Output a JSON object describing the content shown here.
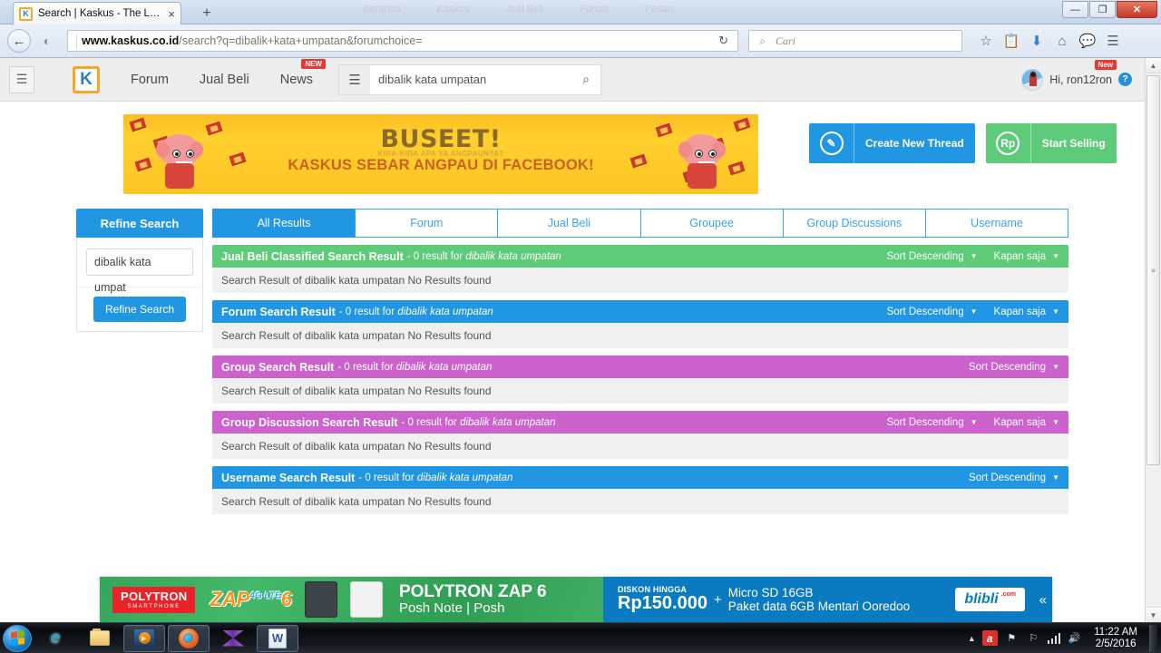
{
  "browser": {
    "tab_title": "Search | Kaskus - The Large...",
    "tab_favicon": "K",
    "tab_close_icon": "×",
    "new_tab_icon": "+",
    "ghost_tabs": [
      "Beranda",
      "Kaskus",
      "Jual Beli",
      "Forum",
      "Pesan"
    ],
    "window_minimize": "—",
    "window_restore": "❐",
    "window_close": "✕",
    "back_icon": "←",
    "forward_icon": "→",
    "url_site_icon": "◐",
    "url_domain": "www.kaskus.co.id",
    "url_path": "/search?q=dibalik+kata+umpatan&forumchoice=",
    "reload_icon": "↻",
    "search_placeholder": "Cari",
    "search_icon": "⌕",
    "toolbar_icons": [
      "☆",
      "Ὄb",
      "⬇",
      "⌂",
      "◔",
      "☰"
    ]
  },
  "site_nav": {
    "hamburger_icon": "☰",
    "logo_text": "K",
    "items": [
      {
        "label": "Forum",
        "badge": ""
      },
      {
        "label": "Jual Beli",
        "badge": ""
      },
      {
        "label": "News",
        "badge": "NEW"
      }
    ],
    "search_category_icon": "☰",
    "search_value": "dibalik kata umpatan",
    "search_go_icon": "⌕",
    "user_greeting": "Hi, ron12ron",
    "user_badge": "New",
    "help_icon": "?"
  },
  "hero": {
    "banner_line1": "BUSEET!",
    "banner_line2": "KIRA-KIRA APA YA ANGPAUNYA?",
    "banner_line3": "KASKUS SEBAR ANGPAU DI FACEBOOK!",
    "create_thread_label": "Create New Thread",
    "create_thread_icon": "✎",
    "start_selling_label": "Start Selling",
    "start_selling_icon": "Rp"
  },
  "refine": {
    "header": "Refine Search",
    "input_value": "dibalik kata umpat",
    "button_label": "Refine Search"
  },
  "tabs": [
    {
      "label": "All Results",
      "active": true
    },
    {
      "label": "Forum",
      "active": false
    },
    {
      "label": "Jual Beli",
      "active": false
    },
    {
      "label": "Groupee",
      "active": false
    },
    {
      "label": "Group Discussions",
      "active": false
    },
    {
      "label": "Username",
      "active": false
    }
  ],
  "query": "dibalik kata umpatan",
  "results": [
    {
      "title": "Jual Beli Classified Search Result",
      "meta_prefix": "- 0 result for",
      "meta_query": "dibalik kata umpatan",
      "color": "g-green",
      "sort_label": "Sort Descending",
      "time_label": "Kapan saja",
      "body": "Search Result of dibalik kata umpatan No Results found"
    },
    {
      "title": "Forum Search Result",
      "meta_prefix": "- 0 result for",
      "meta_query": "dibalik kata umpatan",
      "color": "g-blue",
      "sort_label": "Sort Descending",
      "time_label": "Kapan saja",
      "body": "Search Result of dibalik kata umpatan No Results found"
    },
    {
      "title": "Group Search Result",
      "meta_prefix": "- 0 result for",
      "meta_query": "dibalik kata umpatan",
      "color": "g-purple",
      "sort_label": "Sort Descending",
      "time_label": "",
      "body": "Search Result of dibalik kata umpatan No Results found"
    },
    {
      "title": "Group Discussion Search Result",
      "meta_prefix": "- 0 result for",
      "meta_query": "dibalik kata umpatan",
      "color": "g-purple",
      "sort_label": "Sort Descending",
      "time_label": "Kapan saja",
      "body": "Search Result of dibalik kata umpatan No Results found"
    },
    {
      "title": "Username Search Result",
      "meta_prefix": "- 0 result for",
      "meta_query": "dibalik kata umpatan",
      "color": "g-blue",
      "sort_label": "Sort Descending",
      "time_label": "",
      "body": "Search Result of dibalik kata umpatan No Results found"
    }
  ],
  "ad": {
    "brand_name": "POLYTRON",
    "brand_sub": "SMARTPHONE",
    "product_badge": "ZAP",
    "product_badge_num": "6",
    "product_badge_sup": "4G LTE",
    "headline": "POLYTRON ZAP 6",
    "subhead": "Posh Note | Posh",
    "discount_label": "DISKON HINGGA",
    "discount_value": "Rp150.000",
    "plus": "+",
    "bonus_line1": "Micro SD 16GB",
    "bonus_line2": "Paket data 6GB Mentari Ooredoo",
    "store": "blibli",
    "store_tld": ".com",
    "collapse_icon": "«"
  },
  "taskbar": {
    "apps": [
      "internet-explorer",
      "file-explorer",
      "windows-media-player",
      "firefox",
      "movie-maker",
      "microsoft-word"
    ],
    "tray_arrow": "▲",
    "avira_icon": "a",
    "network_icon": "⚑",
    "action_icon": "⚑",
    "volume_icon": "ὐa",
    "time": "11:22 AM",
    "date": "2/5/2016"
  },
  "colors": {
    "accent_blue": "#2196e3",
    "green": "#5ecb7a",
    "purple": "#cc62cc",
    "badge_red": "#e53935",
    "banner_yellow": "#fdc524"
  }
}
